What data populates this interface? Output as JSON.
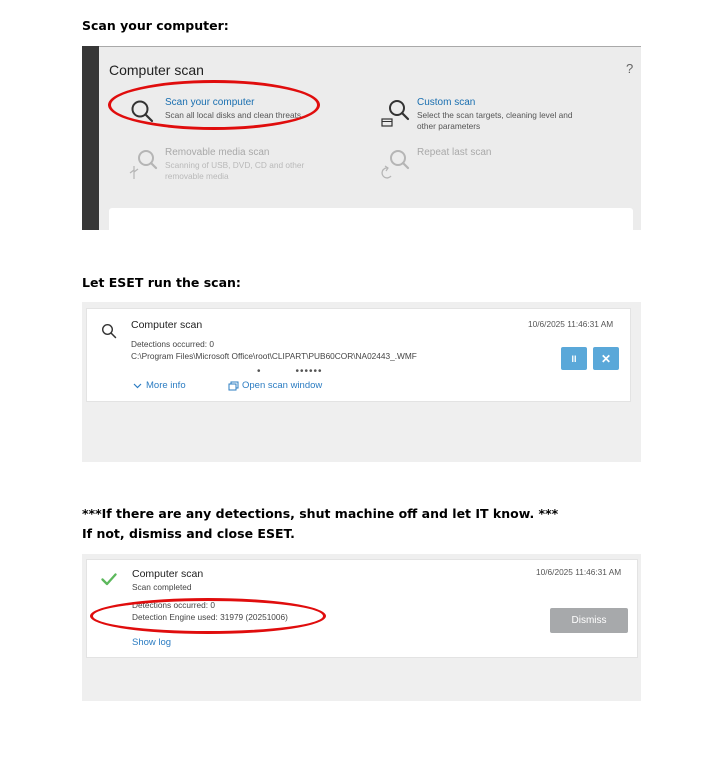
{
  "steps": {
    "step1": "Scan your computer:",
    "step2": "Let ESET run the scan:",
    "step3_line1": "***If there are any detections, shut machine off and let IT know. ***",
    "step3_line2": "If not, dismiss and close ESET."
  },
  "panel1": {
    "title": "Computer scan",
    "help": "?",
    "options": {
      "scan_computer": {
        "title": "Scan your computer",
        "desc": "Scan all local disks and clean threats"
      },
      "custom_scan": {
        "title": "Custom scan",
        "desc1": "Select the scan targets, cleaning level and",
        "desc2": "other parameters"
      },
      "removable": {
        "title": "Removable media scan",
        "desc1": "Scanning of USB, DVD, CD and other",
        "desc2": "removable media"
      },
      "repeat": {
        "title": "Repeat last scan"
      }
    }
  },
  "panel2": {
    "title": "Computer scan",
    "timestamp": "10/6/2025 11:46:31 AM",
    "detections": "Detections occurred: 0",
    "path": "C:\\Program Files\\Microsoft Office\\root\\CLIPART\\PUB60COR\\NA02443_.WMF",
    "more_info": "More info",
    "open_window": "Open scan window",
    "pause_symbol": "II",
    "stop_symbol": "✕",
    "dots": "•         ••••••"
  },
  "panel3": {
    "title": "Computer scan",
    "status": "Scan completed",
    "timestamp": "10/6/2025 11:46:31 AM",
    "detections": "Detections occurred: 0",
    "engine": "Detection Engine used: 31979 (20251006)",
    "show_log": "Show log",
    "dismiss": "Dismiss"
  },
  "colors": {
    "accent_blue": "#1a6fb0",
    "button_blue": "#5aa8d9",
    "check_green": "#5cb85c",
    "annotation_red": "#e00d0d"
  },
  "icons": [
    "search-icon",
    "usb-icon",
    "repeat-icon",
    "custom-scan-icon",
    "chevron-down-icon",
    "window-icon",
    "pause-icon",
    "stop-icon",
    "checkmark-icon"
  ]
}
